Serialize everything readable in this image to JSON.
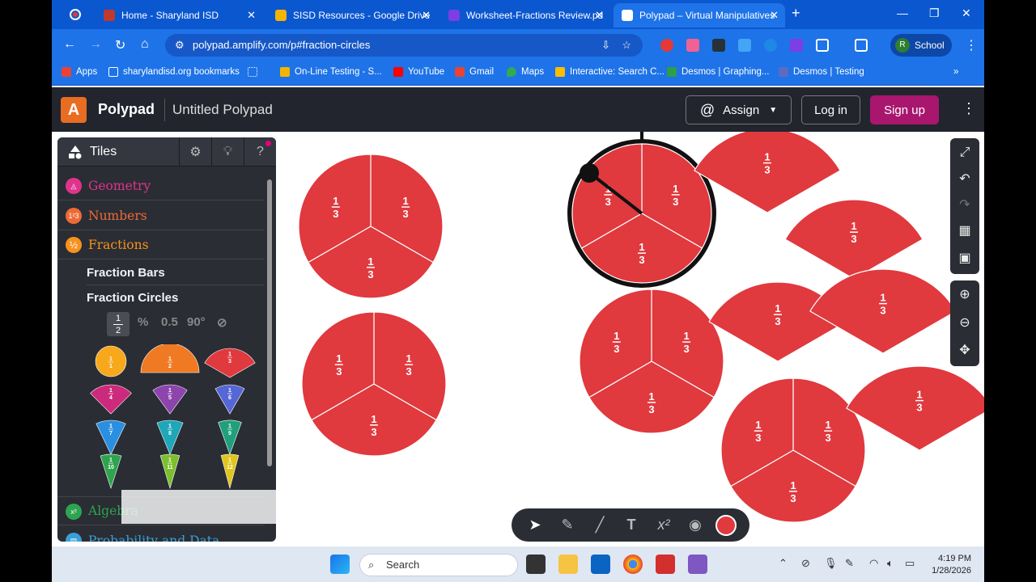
{
  "browser": {
    "tabs": [
      {
        "title": "Home - Sharyland ISD",
        "color": "#c0392b"
      },
      {
        "title": "SISD Resources - Google Drive",
        "color": "#f4b400"
      },
      {
        "title": "Worksheet-Fractions Review.pd",
        "color": "#7b3fe4"
      },
      {
        "title": "Polypad – Virtual Manipulatives",
        "color": "#2c7be5",
        "active": true
      }
    ],
    "url": "polypad.amplify.com/p#fraction-circles",
    "profile_label": "School",
    "profile_initial": "R",
    "bookmarks": [
      {
        "label": "Apps",
        "color": "#ea4335"
      },
      {
        "label": "sharylandisd.org bookmarks",
        "color": "#ffffff"
      },
      {
        "label": "",
        "color": "#ffffff"
      },
      {
        "label": "On-Line Testing - S...",
        "color": "#f4b400"
      },
      {
        "label": "YouTube",
        "color": "#ff0000"
      },
      {
        "label": "Gmail",
        "color": "#ea4335"
      },
      {
        "label": "Maps",
        "color": "#34a853"
      },
      {
        "label": "Interactive: Search C...",
        "color": "#fbbc04"
      },
      {
        "label": "Desmos | Graphing...",
        "color": "#2f9e44"
      },
      {
        "label": "Desmos | Testing",
        "color": "#5c6bc0"
      }
    ]
  },
  "app": {
    "logo_letter": "A",
    "brand": "Polypad",
    "doc_title": "Untitled Polypad",
    "assign_label": "Assign",
    "login_label": "Log in",
    "signup_label": "Sign up"
  },
  "panel": {
    "title": "Tiles",
    "categories": [
      {
        "label": "Geometry",
        "color": "#e0338b"
      },
      {
        "label": "Numbers",
        "color": "#ee6a35"
      },
      {
        "label": "Fractions",
        "color": "#f7921e"
      },
      {
        "label": "Algebra",
        "color": "#2ea44f"
      },
      {
        "label": "Probability and Data",
        "color": "#3aa0d8"
      }
    ],
    "sub_items": [
      "Fraction Bars",
      "Fraction Circles"
    ],
    "format_options": [
      "%",
      "0.5",
      "90°"
    ],
    "format_selected_num": "1",
    "format_selected_den": "2",
    "category_icons": {
      "numbers": "1²3",
      "fractions": "½",
      "algebra": "x²"
    }
  },
  "tiles": [
    {
      "num": "1",
      "den": "1",
      "color": "#f7a81b"
    },
    {
      "num": "1",
      "den": "2",
      "color": "#f07a23"
    },
    {
      "num": "1",
      "den": "3",
      "color": "#e0393e"
    },
    {
      "num": "1",
      "den": "4",
      "color": "#cc2a7c"
    },
    {
      "num": "1",
      "den": "5",
      "color": "#8e44ad"
    },
    {
      "num": "1",
      "den": "6",
      "color": "#5567d6"
    },
    {
      "num": "1",
      "den": "7",
      "color": "#2a8fe0"
    },
    {
      "num": "1",
      "den": "8",
      "color": "#1fa6b8"
    },
    {
      "num": "1",
      "den": "9",
      "color": "#1fa07a"
    },
    {
      "num": "1",
      "den": "10",
      "color": "#2ea44f"
    },
    {
      "num": "1",
      "den": "11",
      "color": "#7cbf2c"
    },
    {
      "num": "1",
      "den": "12",
      "color": "#e0c51b"
    }
  ],
  "fraction_label": {
    "num": "1",
    "den": "3"
  },
  "piece_color": "#e0393e",
  "taskbar": {
    "search_label": "Search",
    "time": "4:19 PM",
    "date": "1/28/2026"
  }
}
